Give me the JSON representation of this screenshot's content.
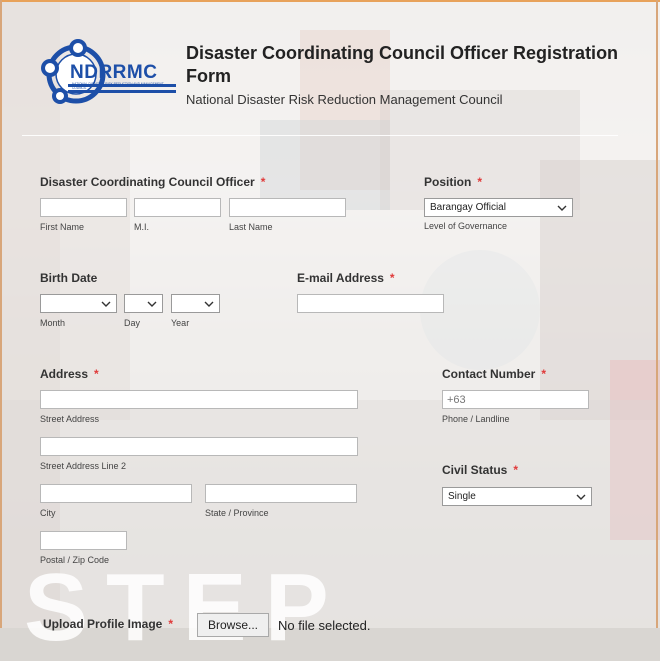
{
  "header": {
    "logo_text": "NDRRMC",
    "logo_small": "NATIONAL DISASTER RISK REDUCTION AND MANAGEMENT COUNCIL",
    "title": "Disaster Coordinating Council Officer Registration Form",
    "subtitle": "National Disaster Risk Reduction Management Council"
  },
  "officer": {
    "label": "Disaster Coordinating Council Officer",
    "required": "*",
    "first_name_value": "",
    "mi_value": "",
    "last_name_value": "",
    "first_name_sub": "First Name",
    "mi_sub": "M.I.",
    "last_name_sub": "Last Name"
  },
  "position": {
    "label": "Position",
    "required": "*",
    "value": "Barangay Official",
    "sub": "Level of Governance"
  },
  "birth": {
    "label": "Birth Date",
    "month_value": "",
    "day_value": "",
    "year_value": "",
    "month_sub": "Month",
    "day_sub": "Day",
    "year_sub": "Year"
  },
  "email": {
    "label": "E-mail Address",
    "required": "*",
    "value": ""
  },
  "address": {
    "label": "Address",
    "required": "*",
    "street_sub": "Street Address",
    "street2_sub": "Street Address Line 2",
    "city_sub": "City",
    "state_sub": "State / Province",
    "postal_sub": "Postal / Zip Code"
  },
  "contact": {
    "label": "Contact Number",
    "required": "*",
    "placeholder": "+63",
    "sub": "Phone / Landline"
  },
  "civil": {
    "label": "Civil Status",
    "required": "*",
    "value": "Single"
  },
  "upload": {
    "label": "Upload Profile Image",
    "required": "*",
    "button": "Browse...",
    "status": "No file selected."
  },
  "watermark": "STEP",
  "colors": {
    "required": "#e03a3a",
    "accent_border": "#e8a25a",
    "logo_blue": "#1d4fa8"
  }
}
